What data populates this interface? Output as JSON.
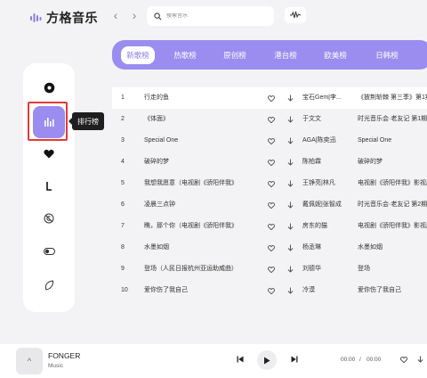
{
  "app": {
    "title": "方格音乐"
  },
  "search": {
    "placeholder": "搜索音乐"
  },
  "sidebar": {
    "tooltip": "排行榜",
    "items": [
      {
        "icon": "disc-icon"
      },
      {
        "icon": "chart-bars-icon"
      },
      {
        "icon": "heart-icon"
      },
      {
        "icon": "music-note-icon"
      },
      {
        "icon": "no-copyright-icon"
      },
      {
        "icon": "toggle-icon"
      },
      {
        "icon": "leaf-icon"
      }
    ]
  },
  "tabs": [
    {
      "label": "新歌榜",
      "active": true
    },
    {
      "label": "热歌榜",
      "active": false
    },
    {
      "label": "原创榜",
      "active": false
    },
    {
      "label": "港台榜",
      "active": false
    },
    {
      "label": "欧美榜",
      "active": false
    },
    {
      "label": "日韩榜",
      "active": false
    }
  ],
  "songs": [
    {
      "num": "1",
      "title": "行走的鱼",
      "artist": "宝石Gem|李...",
      "album": "《披荆斩棘 第三季》第1期"
    },
    {
      "num": "2",
      "title": "《体面》",
      "artist": "于文文",
      "album": "时光音乐会·老友记 第1期"
    },
    {
      "num": "3",
      "title": "Special One",
      "artist": "AGA|陈奕迅",
      "album": "Special One"
    },
    {
      "num": "4",
      "title": "破碎的梦",
      "artist": "陈柏霖",
      "album": "破碎的梦"
    },
    {
      "num": "5",
      "title": "我想我愿意（电视剧《骄阳伴我》",
      "artist": "王铮亮|林凡",
      "album": "电视剧《骄阳伴我》影视原声带"
    },
    {
      "num": "6",
      "title": "凌晨三点钟",
      "artist": "戴佩妮|张智成",
      "album": "时光音乐会·老友记 第2期"
    },
    {
      "num": "7",
      "title": "瞧，那个你（电视剧《骄阳伴我》",
      "artist": "房东的猫",
      "album": "电视剧《骄阳伴我》影视原声带"
    },
    {
      "num": "8",
      "title": "水墨如烟",
      "artist": "杨丞琳",
      "album": "水墨如烟"
    },
    {
      "num": "9",
      "title": "登场（人民日报杭州亚运助威曲）",
      "artist": "刘德华",
      "album": "登场"
    },
    {
      "num": "10",
      "title": "爱你伤了我自己",
      "artist": "冷漠",
      "album": "爱你伤了我自己"
    }
  ],
  "player": {
    "cover_icon": "^",
    "song_name": "FONGER",
    "song_sub": "Music",
    "current_time": "00:00",
    "separator": "/",
    "total_time": "00:00"
  },
  "colors": {
    "accent": "#9b8cf0",
    "highlight": "#e53935"
  }
}
